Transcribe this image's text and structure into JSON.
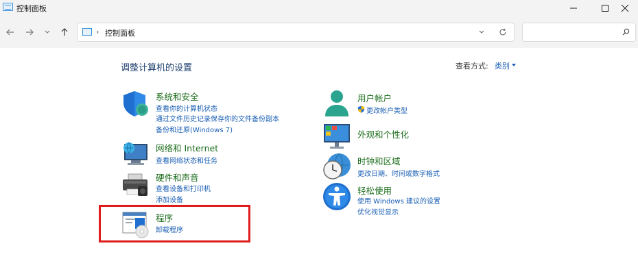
{
  "window": {
    "title": "控制面板"
  },
  "address": {
    "crumb": "控制面板"
  },
  "search": {
    "placeholder": ""
  },
  "header": {
    "heading": "调整计算机的设置",
    "view_by_label": "查看方式:",
    "view_by_value": "类别"
  },
  "categories": [
    {
      "title": "系统和安全",
      "icon": "shield-icon",
      "links": [
        "查看你的计算机状态",
        "通过文件历史记录保存你的文件备份副本",
        "备份和还原(Windows 7)"
      ]
    },
    {
      "title": "网络和 Internet",
      "icon": "network-icon",
      "links": [
        "查看网络状态和任务"
      ]
    },
    {
      "title": "硬件和声音",
      "icon": "printer-icon",
      "links": [
        "查看设备和打印机",
        "添加设备"
      ]
    },
    {
      "title": "程序",
      "icon": "programs-icon",
      "links": [
        "卸载程序"
      ]
    },
    {
      "title": "用户帐户",
      "icon": "user-icon",
      "links": [
        "更改帐户类型"
      ]
    },
    {
      "title": "外观和个性化",
      "icon": "monitor-icon",
      "links": []
    },
    {
      "title": "时钟和区域",
      "icon": "clock-globe-icon",
      "links": [
        "更改日期、时间或数字格式"
      ]
    },
    {
      "title": "轻松使用",
      "icon": "accessibility-icon",
      "links": [
        "使用 Windows 建议的设置",
        "优化视觉显示"
      ]
    }
  ],
  "colors": {
    "title_green": "#1b6c1b",
    "link_blue": "#1a5fb4",
    "heading_blue": "#1e3f6e",
    "highlight_red": "#e01b1b",
    "chrome_bg": "#f3f3f3"
  }
}
